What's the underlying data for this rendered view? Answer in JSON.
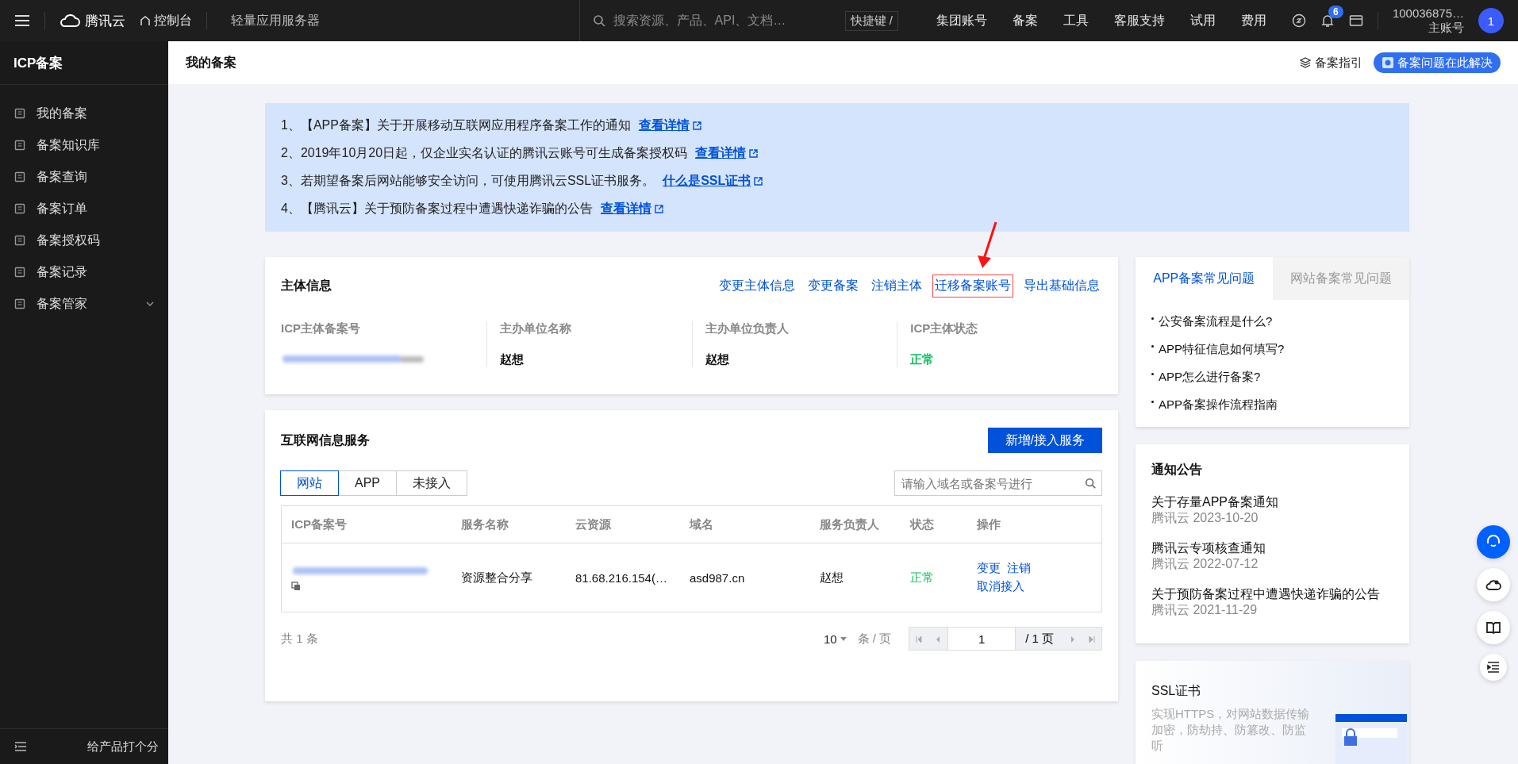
{
  "topbar": {
    "brand": "腾讯云",
    "console": "控制台",
    "product": "轻量应用服务器",
    "search_placeholder": "搜索资源、产品、API、文档…",
    "shortcut": "快捷键 /",
    "nav": [
      "集团账号",
      "备案",
      "工具",
      "客服支持",
      "试用",
      "费用"
    ],
    "notification_count": "6",
    "account_id": "100036875…",
    "account_type": "主账号",
    "avatar": "1"
  },
  "sidebar": {
    "title": "ICP备案",
    "items": [
      {
        "label": "我的备案",
        "selected": false,
        "expandable": false
      },
      {
        "label": "备案知识库",
        "selected": false,
        "expandable": false
      },
      {
        "label": "备案查询",
        "selected": false,
        "expandable": false
      },
      {
        "label": "备案订单",
        "selected": false,
        "expandable": false
      },
      {
        "label": "备案授权码",
        "selected": false,
        "expandable": false
      },
      {
        "label": "备案记录",
        "selected": false,
        "expandable": false
      },
      {
        "label": "备案管家",
        "selected": false,
        "expandable": true
      }
    ],
    "footer": "给产品打个分"
  },
  "header": {
    "title": "我的备案",
    "guide": "备案指引",
    "help": "备案问题在此解决"
  },
  "notices": [
    {
      "text": "1、【APP备案】关于开展移动互联网应用程序备案工作的通知",
      "link": "查看详情"
    },
    {
      "text": "2、2019年10月20日起，仅企业实名认证的腾讯云账号可生成备案授权码",
      "link": "查看详情"
    },
    {
      "text": "3、若期望备案后网站能够安全访问，可使用腾讯云SSL证书服务。",
      "link": "什么是SSL证书"
    },
    {
      "text": "4、【腾讯云】关于预防备案过程中遭遇快递诈骗的公告",
      "link": "查看详情"
    }
  ],
  "subject": {
    "title": "主体信息",
    "actions": [
      {
        "label": "变更主体信息",
        "highlighted": false
      },
      {
        "label": "变更备案",
        "highlighted": false
      },
      {
        "label": "注销主体",
        "highlighted": false
      },
      {
        "label": "迁移备案账号",
        "highlighted": true
      },
      {
        "label": "导出基础信息",
        "highlighted": false
      }
    ],
    "fields": [
      {
        "label": "ICP主体备案号",
        "kind": "redacted"
      },
      {
        "label": "主办单位名称",
        "kind": "text",
        "value": "赵想"
      },
      {
        "label": "主办单位负责人",
        "kind": "text",
        "value": "赵想"
      },
      {
        "label": "ICP主体状态",
        "kind": "status",
        "value": "正常"
      }
    ]
  },
  "services": {
    "title": "互联网信息服务",
    "add_button": "新增/接入服务",
    "tabs": [
      {
        "label": "网站",
        "selected": true
      },
      {
        "label": "APP",
        "selected": false
      },
      {
        "label": "未接入",
        "selected": false
      }
    ],
    "search_placeholder": "请输入域名或备案号进行",
    "table": {
      "columns": [
        "ICP备案号",
        "服务名称",
        "云资源",
        "域名",
        "服务负责人",
        "状态",
        "操作"
      ],
      "rows": [
        {
          "service": "资源整合分享",
          "resource": "81.68.216.154(…",
          "domain": "asd987.cn",
          "owner": "赵想",
          "status": "正常",
          "actions": [
            "变更",
            "注销",
            "取消接入"
          ]
        }
      ]
    },
    "total": "共 1 条",
    "page_size": "10",
    "per_page": "条 / 页",
    "page": "1",
    "pages": "/ 1 页"
  },
  "faq": {
    "tabs": [
      {
        "label": "APP备案常见问题",
        "selected": true
      },
      {
        "label": "网站备案常见问题",
        "selected": false
      }
    ],
    "items": [
      "公安备案流程是什么?",
      "APP特征信息如何填写?",
      "APP怎么进行备案?",
      "APP备案操作流程指南"
    ]
  },
  "announcements": {
    "title": "通知公告",
    "items": [
      {
        "title": "关于存量APP备案通知",
        "meta": "腾讯云 2023-10-20"
      },
      {
        "title": "腾讯云专项核查通知",
        "meta": "腾讯云 2022-07-12"
      },
      {
        "title": "关于预防备案过程中遭遇快递诈骗的公告",
        "meta": "腾讯云 2021-11-29"
      }
    ]
  },
  "ssl": {
    "title": "SSL证书",
    "description": "实现HTTPS，对网站数据传输加密，防劫持、防篡改、防监听"
  }
}
